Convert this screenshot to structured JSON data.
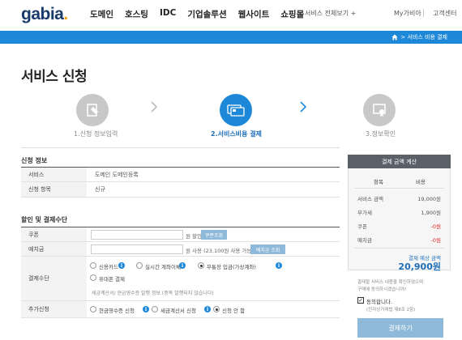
{
  "header": {
    "logo": "gabia",
    "logo_dot": ".",
    "nav": [
      "도메인",
      "호스팅",
      "IDC",
      "기업솔루션",
      "웹사이트",
      "쇼핑몰"
    ],
    "all_services": "서비스 전체보기 +",
    "my_gabia": "My가비아",
    "cs_center": "고객센터"
  },
  "breadcrumb": "> 서비스 비용 결제",
  "page_title": "서비스 신청",
  "steps": [
    {
      "label": "1.신청 정보입력",
      "state": "done"
    },
    {
      "label": "2.서비스비용 결제",
      "state": "active"
    },
    {
      "label": "3.정보확인",
      "state": "pending"
    }
  ],
  "apply_info": {
    "title": "신청 정보",
    "rows": [
      {
        "label": "서비스",
        "value": "도메인 도메인등록"
      },
      {
        "label": "신청 항목",
        "value": "신규"
      }
    ]
  },
  "discount": {
    "title": "할인 및 결제수단",
    "coupon_label": "쿠폰",
    "coupon_unit": "원 할인",
    "coupon_button": "쿠폰조회",
    "deposit_label": "예치금",
    "deposit_unit": "원 사용 (23,100원 사용 가능)",
    "deposit_button": "예치금 조회",
    "payment_label": "결제수단",
    "payment_options": [
      "신용카드",
      "실시간 계좌이체",
      "무통장 입금(가상계좌)",
      "휴대폰 결제"
    ],
    "payment_selected": 2,
    "payment_note": "세금계산서/ 현금영수증 발행 정보 (중복 발행되지 않습니다)",
    "extra_label": "추가신청",
    "extra_options": [
      "현금영수증 신청",
      "세금계산서 신청",
      "신청 안 함"
    ],
    "extra_selected": 2
  },
  "summary": {
    "title": "결제 금액 계산",
    "col_item": "항목",
    "col_cost": "비용",
    "rows": [
      {
        "label": "서비스 금액",
        "value": "19,000원",
        "red": false
      },
      {
        "label": "부가세",
        "value": "1,900원",
        "red": false
      },
      {
        "label": "쿠폰",
        "value": "-0원",
        "red": true
      },
      {
        "label": "예치금",
        "value": "-0원",
        "red": true
      }
    ],
    "total_label": "결제 예상 금액",
    "total_value": "20,900원",
    "notice_1": "결제할 서비스 내용을 확인하였으며",
    "notice_2": "구매에 동의하시겠습니까?",
    "agree_label": "동의합니다.",
    "notice_3": "(전자상거래법 제8조 2항)",
    "pay_button": "결제하기"
  },
  "colors": {
    "brand_blue": "#1e88d8",
    "logo_navy": "#1a3a6b",
    "total_blue": "#1e6fb8",
    "button_light_blue": "#8fb9d8",
    "discount_red": "#e02424"
  }
}
